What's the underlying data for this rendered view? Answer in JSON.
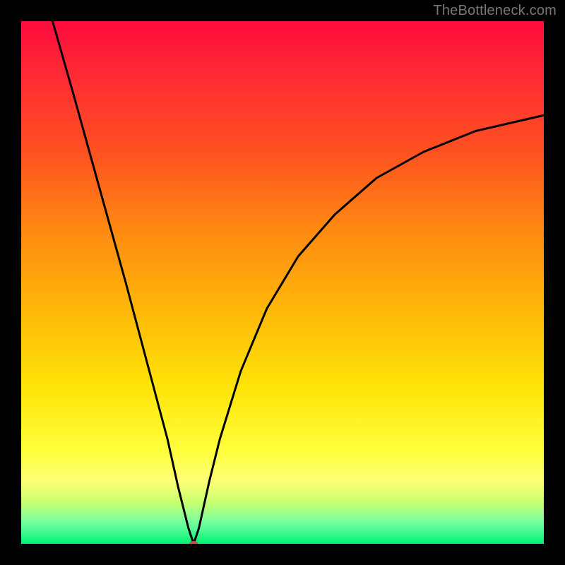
{
  "watermark": "TheBottleneck.com",
  "chart_data": {
    "type": "line",
    "title": "",
    "xlabel": "",
    "ylabel": "",
    "xlim": [
      0,
      100
    ],
    "ylim": [
      0,
      100
    ],
    "background_gradient_stops": [
      {
        "pos": 0,
        "color": "#ff0b3d"
      },
      {
        "pos": 25,
        "color": "#ff5120"
      },
      {
        "pos": 55,
        "color": "#ffb709"
      },
      {
        "pos": 82,
        "color": "#ffff3a"
      },
      {
        "pos": 96,
        "color": "#73ffa0"
      },
      {
        "pos": 100,
        "color": "#00f376"
      }
    ],
    "minimum_marker": {
      "x": 33,
      "y": 0,
      "color": "#d24a4a",
      "rx": 6,
      "ry": 4
    },
    "series": [
      {
        "name": "curve",
        "color": "#000000",
        "points": [
          {
            "x": 6,
            "y": 100
          },
          {
            "x": 10,
            "y": 86
          },
          {
            "x": 15,
            "y": 68
          },
          {
            "x": 20,
            "y": 50
          },
          {
            "x": 24,
            "y": 35
          },
          {
            "x": 28,
            "y": 20
          },
          {
            "x": 30,
            "y": 11
          },
          {
            "x": 32,
            "y": 3
          },
          {
            "x": 33,
            "y": 0
          },
          {
            "x": 34,
            "y": 3
          },
          {
            "x": 36,
            "y": 12
          },
          {
            "x": 38,
            "y": 20
          },
          {
            "x": 42,
            "y": 33
          },
          {
            "x": 47,
            "y": 45
          },
          {
            "x": 53,
            "y": 55
          },
          {
            "x": 60,
            "y": 63
          },
          {
            "x": 68,
            "y": 70
          },
          {
            "x": 77,
            "y": 75
          },
          {
            "x": 87,
            "y": 79
          },
          {
            "x": 100,
            "y": 82
          }
        ]
      }
    ]
  }
}
